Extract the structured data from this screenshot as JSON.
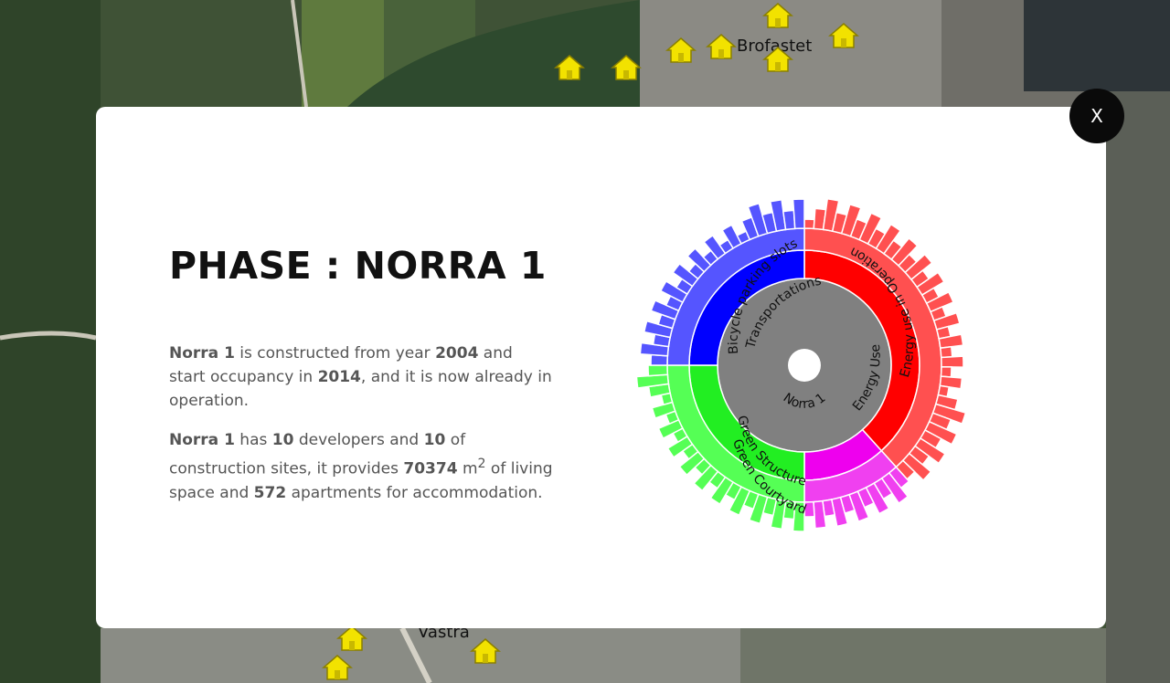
{
  "map": {
    "labels": {
      "north": "Brofastet",
      "south": "Vastra"
    }
  },
  "modal": {
    "close_label": "X",
    "title": "PHASE : NORRA 1",
    "para1": {
      "name": "Norra 1",
      "t1": " is constructed from year ",
      "year_start": "2004",
      "t2": " and start occupancy in ",
      "year_occ": "2014",
      "t3": ", and it is now already in operation."
    },
    "para2": {
      "name": "Norra 1",
      "t1": " has ",
      "developers": "10",
      "t2": " developers and ",
      "sites": "10",
      "t3": " of construction sites, it provides ",
      "area": "70374",
      "unit": " m",
      "unit_sup": "2",
      "t4": " of living space and ",
      "apartments": "572",
      "t5": " apartments for accommodation."
    }
  },
  "sunburst": {
    "center_label": "Norra 1",
    "categories": [
      {
        "label": "Energy Use",
        "color": "#ff0000",
        "start_deg": 0,
        "end_deg": 138,
        "sub": [
          {
            "label": "Energy use in Operation",
            "color": "#ff5050",
            "start_deg": 0,
            "end_deg": 138
          }
        ]
      },
      {
        "label": "",
        "color": "#ee00ee",
        "start_deg": 138,
        "end_deg": 180,
        "sub": [
          {
            "label": "",
            "color": "#f040f0",
            "start_deg": 138,
            "end_deg": 180
          }
        ]
      },
      {
        "label": "Green Structure",
        "color": "#22ee22",
        "start_deg": 180,
        "end_deg": 270,
        "sub": [
          {
            "label": "Green Courtyard",
            "color": "#55ff55",
            "start_deg": 180,
            "end_deg": 270
          }
        ]
      },
      {
        "label": "Transportations",
        "color": "#0000ff",
        "start_deg": 270,
        "end_deg": 360,
        "sub": [
          {
            "label": "Bicycle parking slots",
            "color": "#5555ff",
            "start_deg": 270,
            "end_deg": 360
          }
        ]
      }
    ]
  }
}
